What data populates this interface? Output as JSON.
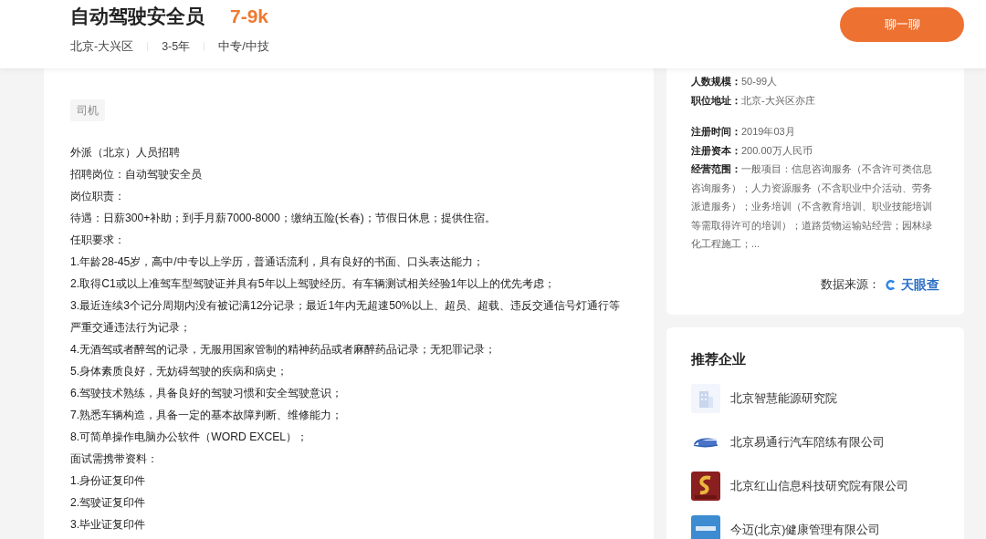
{
  "header": {
    "title": "自动驾驶安全员",
    "salary": "7-9k",
    "meta": [
      "北京-大兴区",
      "3-5年",
      "中专/中技"
    ],
    "chat_button": "聊一聊"
  },
  "job": {
    "tag": "司机",
    "lines": [
      "外派（北京）人员招聘",
      "招聘岗位：自动驾驶安全员",
      "岗位职责：",
      "待遇：日薪300+补助；到手月薪7000-8000；缴纳五险(长春)；节假日休息；提供住宿。",
      "任职要求：",
      "1.年龄28-45岁，高中/中专以上学历，普通话流利，具有良好的书面、口头表达能力；",
      "2.取得C1或以上准驾车型驾驶证并具有5年以上驾驶经历。有车辆测试相关经验1年以上的优先考虑；",
      "3.最近连续3个记分周期内没有被记满12分记录；最近1年内无超速50%以上、超员、超载、违反交通信号灯通行等严重交通违法行为记录；",
      "4.无酒驾或者醉驾的记录，无服用国家管制的精神药品或者麻醉药品记录；无犯罪记录；",
      "5.身体素质良好，无妨碍驾驶的疾病和病史；",
      "6.驾驶技术熟练，具备良好的驾驶习惯和安全驾驶意识；",
      "7.熟悉车辆构造，具备一定的基本故障判断、维修能力；",
      "8.可简单操作电脑办公软件（WORD EXCEL）；",
      "面试需携带资料：",
      "1.身份证复印件",
      "2.驾驶证复印件",
      "3.毕业证复印件"
    ]
  },
  "company_info": {
    "groups": [
      [
        {
          "label": "人数规模：",
          "value": "50-99人"
        },
        {
          "label": "职位地址：",
          "value": "北京-大兴区亦庄"
        }
      ],
      [
        {
          "label": "注册时间：",
          "value": "2019年03月"
        },
        {
          "label": "注册资本：",
          "value": "200.00万人民币"
        },
        {
          "label": "经营范围：",
          "value": "一般项目：信息咨询服务（不含许可类信息咨询服务）；人力资源服务（不含职业中介活动、劳务派遣服务）；业务培训（不含教育培训、职业技能培训等需取得许可的培训）；道路货物运输站经营；园林绿化工程施工；..."
        }
      ]
    ],
    "source_label": "数据来源：",
    "source_name": "天眼查"
  },
  "recommended": {
    "title": "推荐企业",
    "companies": [
      {
        "name": "北京智慧能源研究院",
        "kind": "building"
      },
      {
        "name": "北京易通行汽车陪练有限公司",
        "kind": "wordmark"
      },
      {
        "name": "北京红山信息科技研究院有限公司",
        "kind": "emblem"
      },
      {
        "name": "今迈(北京)健康管理有限公司",
        "kind": "square"
      }
    ]
  }
}
